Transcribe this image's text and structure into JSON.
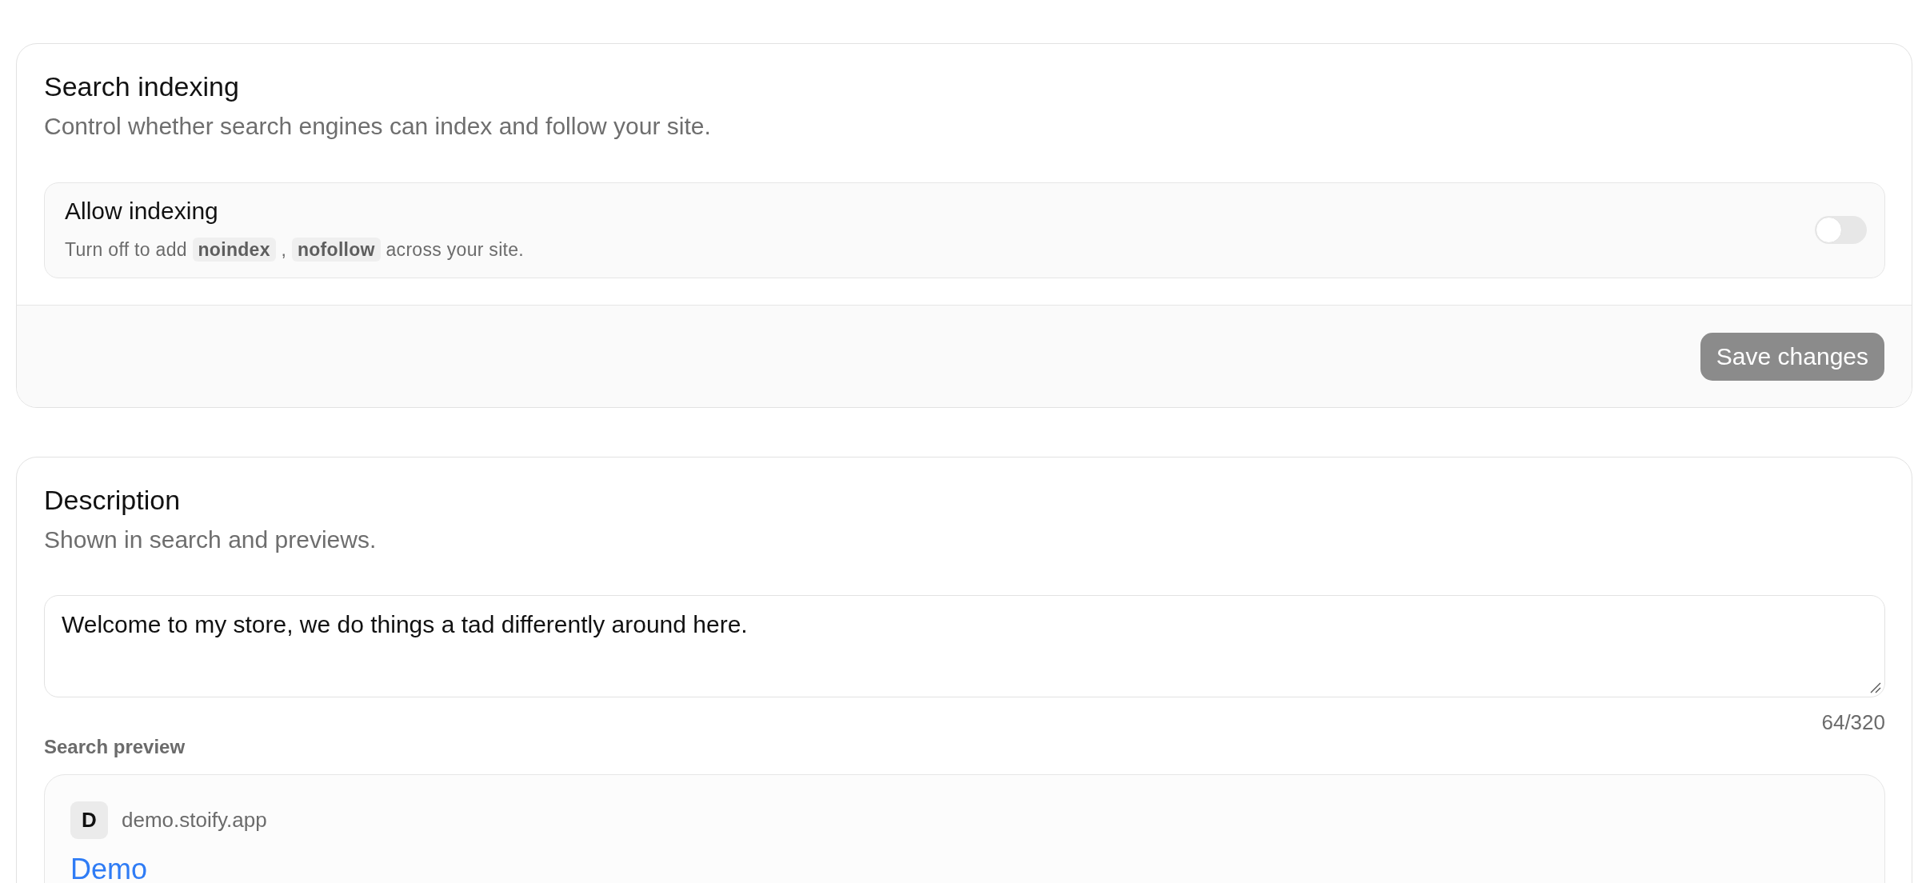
{
  "search_indexing": {
    "title": "Search indexing",
    "subtitle": "Control whether search engines can index and follow your site.",
    "setting": {
      "label": "Allow indexing",
      "hint": [
        {
          "kind": "text",
          "text": "Turn off to add "
        },
        {
          "kind": "code",
          "text": "noindex"
        },
        {
          "kind": "text",
          "text": " , "
        },
        {
          "kind": "code",
          "text": "nofollow"
        },
        {
          "kind": "text",
          "text": " across your site."
        }
      ],
      "on": false
    },
    "save_button": {
      "label": "Save changes",
      "disabled": true
    }
  },
  "description": {
    "title": "Description",
    "subtitle": "Shown in search and previews.",
    "field": {
      "value": "Welcome to my store, we do things a tad differently around here.",
      "counter": "64/320"
    },
    "preview": {
      "label": "Search preview",
      "site_initial": "D",
      "url": "demo.stoify.app",
      "title": "Demo"
    }
  }
}
